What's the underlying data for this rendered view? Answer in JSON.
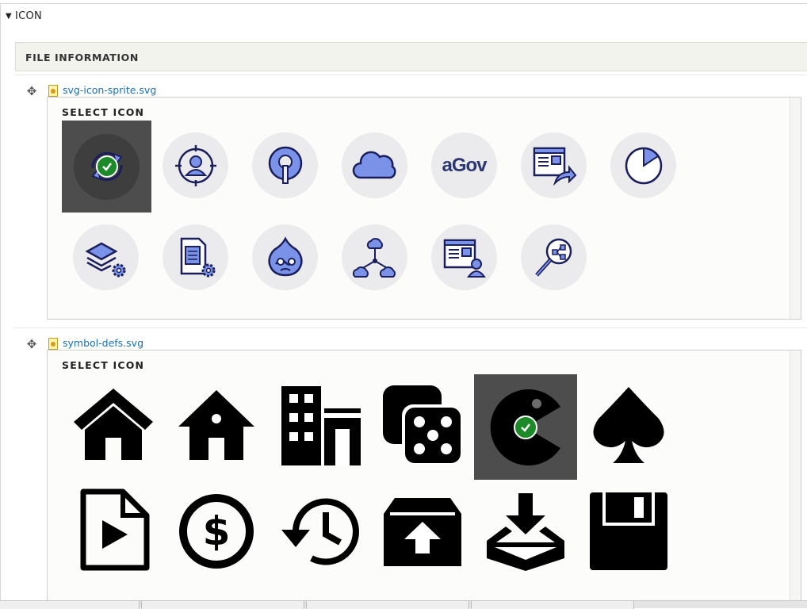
{
  "details": {
    "summary": "ICON",
    "expanded": true
  },
  "fieldset": {
    "title": "FILE INFORMATION"
  },
  "files": [
    {
      "filename": "svg-icon-sprite.svg",
      "select_label": "SELECT ICON",
      "selected_icon": "sync-icon",
      "icons": [
        "sync-icon",
        "user-target-icon",
        "openid-icon",
        "cloud-icon",
        "agov-icon",
        "webpage-share-icon",
        "pie-chart-icon",
        "layers-gear-icon",
        "document-gear-icon",
        "drupal-icon",
        "cloud-network-icon",
        "webpage-user-icon",
        "magnify-network-icon"
      ],
      "agov_text": "aGov"
    },
    {
      "filename": "symbol-defs.svg",
      "select_label": "SELECT ICON",
      "selected_icon": "pacman-icon",
      "icons": [
        "home-icon",
        "home-small-icon",
        "office-icon",
        "dice-icon",
        "pacman-icon",
        "spades-icon",
        "file-play-icon",
        "coin-dollar-icon",
        "history-icon",
        "box-upload-icon",
        "download-tray-icon",
        "floppy-disk-icon"
      ]
    }
  ],
  "colors": {
    "accent": "#7a93e8",
    "stroke": "#1a1f5c",
    "selected_bg": "#4d4d4d",
    "check": "#1d8a2a",
    "link": "#1b6fb3"
  }
}
